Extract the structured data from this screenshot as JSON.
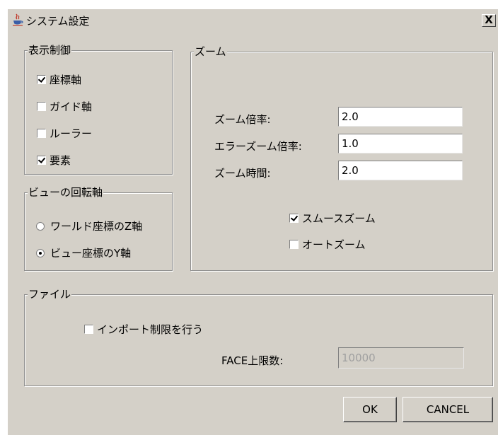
{
  "window": {
    "title": "システム設定",
    "close_label": "X"
  },
  "display_control": {
    "legend": "表示制御",
    "items": [
      {
        "label": "座標軸",
        "checked": true
      },
      {
        "label": "ガイド軸",
        "checked": false
      },
      {
        "label": "ルーラー",
        "checked": false
      },
      {
        "label": "要素",
        "checked": true
      }
    ]
  },
  "rotation_axis": {
    "legend": "ビューの回転軸",
    "options": [
      {
        "label": "ワールド座標のZ軸",
        "selected": false
      },
      {
        "label": "ビュー座標のY軸",
        "selected": true
      }
    ]
  },
  "zoom": {
    "legend": "ズーム",
    "fields": [
      {
        "label": "ズーム倍率:",
        "value": "2.0"
      },
      {
        "label": "エラーズーム倍率:",
        "value": "1.0"
      },
      {
        "label": "ズーム時間:",
        "value": "2.0"
      }
    ],
    "smooth_zoom": {
      "label": "スムースズーム",
      "checked": true
    },
    "auto_zoom": {
      "label": "オートズーム",
      "checked": false
    }
  },
  "file": {
    "legend": "ファイル",
    "import_limit": {
      "label": "インポート制限を行う",
      "checked": false
    },
    "face_limit_label": "FACE上限数:",
    "face_limit_value": "10000"
  },
  "buttons": {
    "ok": "OK",
    "cancel": "CANCEL"
  }
}
